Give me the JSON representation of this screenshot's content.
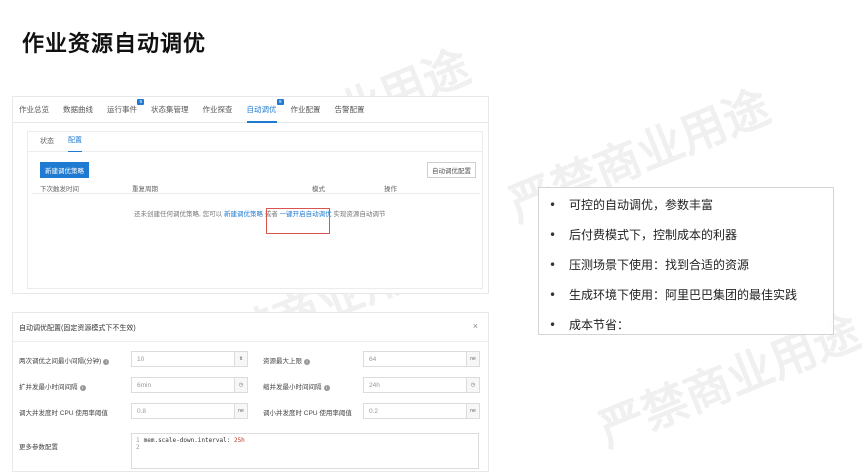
{
  "slide": {
    "title": "作业资源自动调优"
  },
  "watermark": {
    "text": "严禁商业用途"
  },
  "console": {
    "tabs": [
      {
        "label": "作业总览",
        "badge": ""
      },
      {
        "label": "数据曲线",
        "badge": ""
      },
      {
        "label": "运行事件",
        "badge": "9"
      },
      {
        "label": "状态集管理",
        "badge": ""
      },
      {
        "label": "作业探查",
        "badge": ""
      },
      {
        "label": "自动调优",
        "badge": "9"
      },
      {
        "label": "作业配置",
        "badge": ""
      },
      {
        "label": "告警配置",
        "badge": ""
      }
    ],
    "subtabs": [
      "状态",
      "配置"
    ],
    "new_button": "新建调优策略",
    "config_button": "自动调优配置",
    "columns": [
      "下次触发时间",
      "重复周期",
      "模式",
      "操作"
    ],
    "empty": {
      "prefix": "还未创建任何调优策略, 您可以",
      "link1": "新建调优策略",
      "middle": "或者",
      "link2": "一键开启自动调优",
      "suffix": "实现资源自动调节"
    }
  },
  "config": {
    "title": "自动调优配置(固定资源模式下不生效)",
    "close": "×",
    "fields": {
      "min_interval": {
        "label": "两次调优之间最小间隔(分钟)",
        "value": "10",
        "unit": "tt"
      },
      "max_resource": {
        "label": "资源最大上限",
        "value": "64",
        "unit": "ne"
      },
      "scale_up_interval": {
        "label": "扩并发最小时间间隔",
        "value": "6min",
        "unit": "◷"
      },
      "scale_down_interval": {
        "label": "缩并发最小时间间隔",
        "value": "24h",
        "unit": "◷"
      },
      "scale_up_cpu": {
        "label": "调大并发度时 CPU 使用率阈值",
        "value": "0.8",
        "unit": "ne"
      },
      "scale_down_cpu": {
        "label": "调小并发度时 CPU 使用率阈值",
        "value": "0.2",
        "unit": "ne"
      }
    },
    "extra": {
      "label": "更多参数配置",
      "lines": [
        {
          "no": "1",
          "key": "mem.scale-down.interval:",
          "val": "25h"
        },
        {
          "no": "2",
          "key": "",
          "val": ""
        }
      ]
    }
  },
  "bullets": [
    "可控的自动调优，参数丰富",
    "后付费模式下，控制成本的利器",
    "压测场景下使用：找到合适的资源",
    "生成环境下使用：阿里巴巴集团的最佳实践",
    "成本节省："
  ]
}
